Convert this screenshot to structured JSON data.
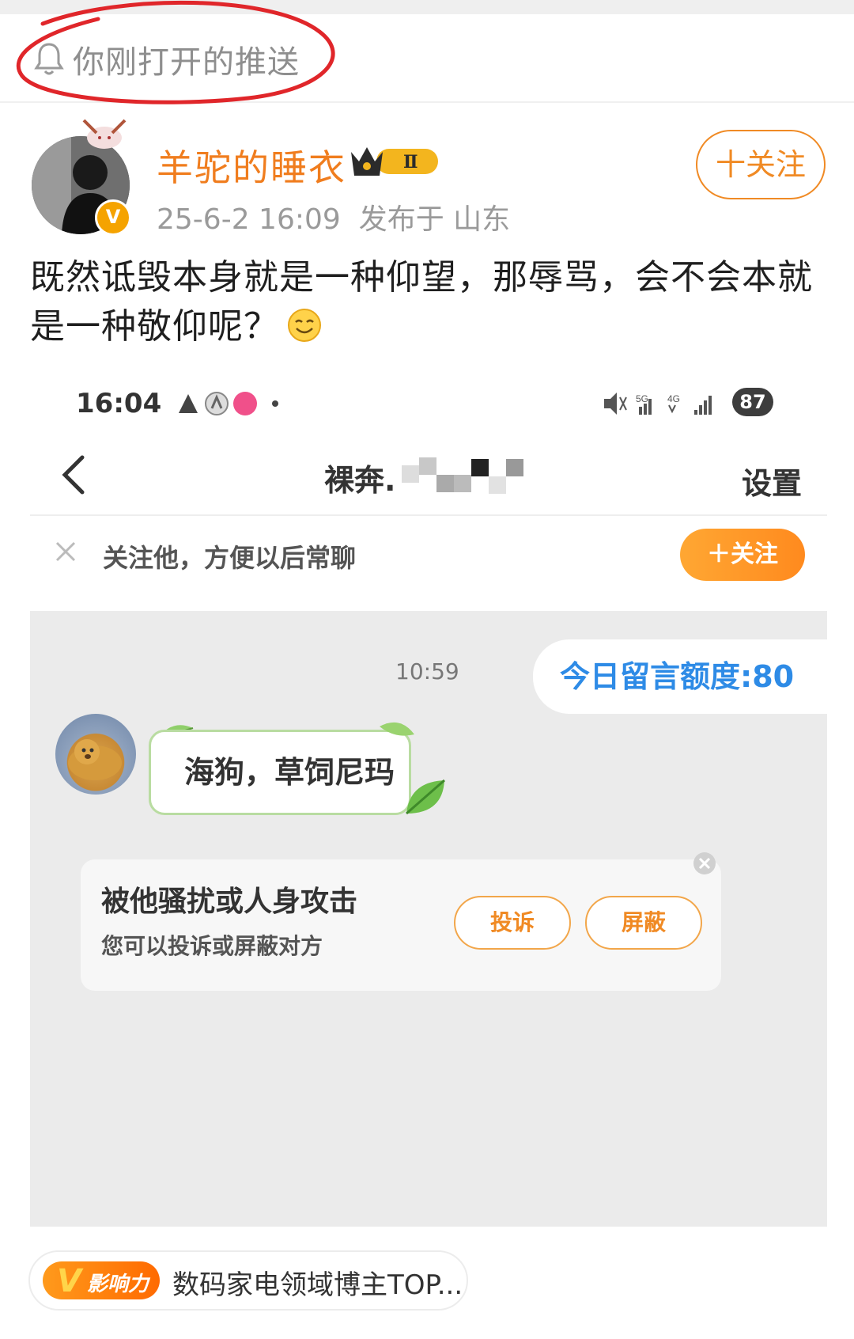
{
  "push_banner": {
    "text": "你刚打开的推送",
    "icon": "bell-icon"
  },
  "post": {
    "author": "羊驼的睡衣",
    "level_badge": "Ⅱ",
    "verified_badge": "V",
    "time": "25-6-2 16:09",
    "location": "发布于 山东",
    "follow_label": "十关注",
    "content": "既然诋毁本身就是一种仰望，那辱骂，会不会本就是一种敬仰呢？",
    "emoji": "smile-emoji-icon"
  },
  "embedded_screenshot": {
    "status_bar": {
      "time": "16:04",
      "battery": "87",
      "right_text": "5G 4G"
    },
    "header": {
      "title": "裸奔.",
      "settings": "设置"
    },
    "follow_bar": {
      "tip": "关注他，方便以后常聊",
      "button": "＋关注"
    },
    "chat": {
      "timestamp": "10:59",
      "quota": "今日留言额度:80",
      "message": "海狗，草饲尼玛"
    },
    "harassment_card": {
      "title": "被他骚扰或人身攻击",
      "subtitle": "您可以投诉或屏蔽对方",
      "complain": "投诉",
      "block": "屏蔽"
    }
  },
  "influence": {
    "badge_letter": "V",
    "badge_label": "影响力",
    "text": "数码家电领域博主TOP..."
  },
  "colors": {
    "accent": "#f07d1e",
    "quota_blue": "#2e8be6",
    "chat_bg": "#ebebeb"
  }
}
